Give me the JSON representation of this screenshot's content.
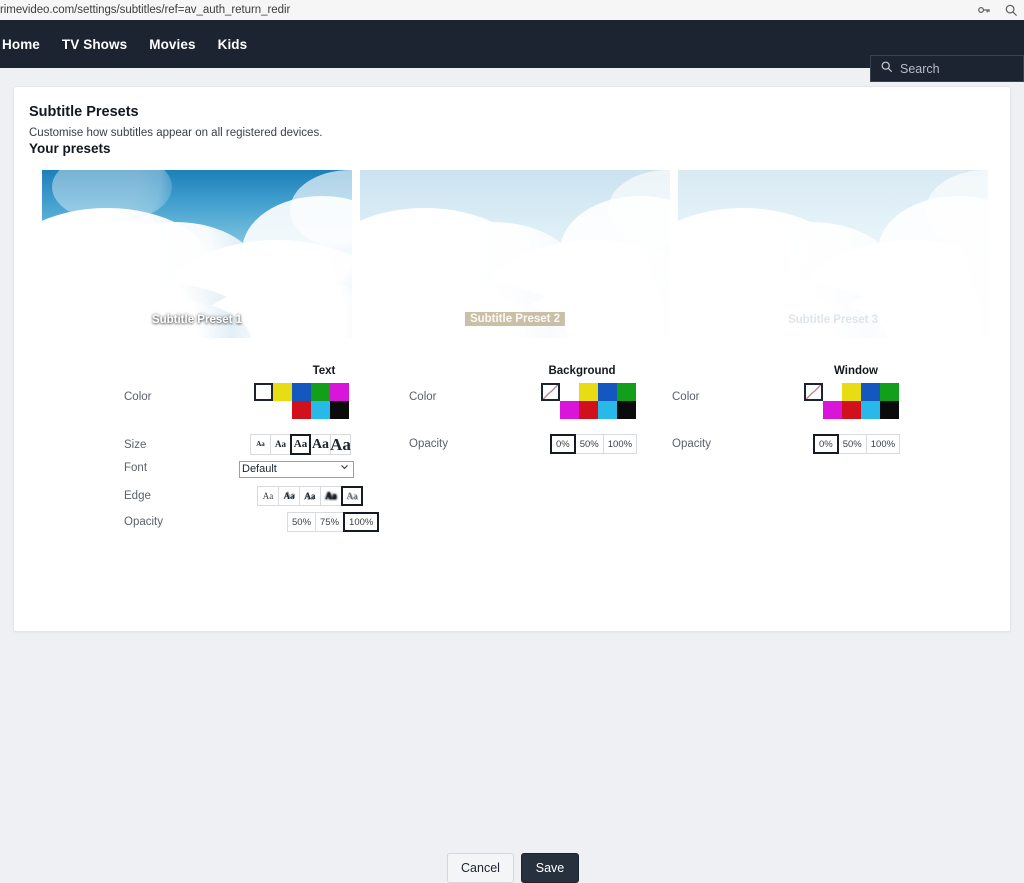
{
  "browser": {
    "url": "rimevideo.com/settings/subtitles/ref=av_auth_return_redir",
    "icons": {
      "key": "key-icon",
      "search": "search-icon"
    }
  },
  "nav": {
    "links": [
      {
        "label": "Home"
      },
      {
        "label": "TV Shows"
      },
      {
        "label": "Movies"
      },
      {
        "label": "Kids"
      }
    ],
    "search": {
      "placeholder": "Search",
      "value": ""
    }
  },
  "page": {
    "title": "Subtitle Presets",
    "subtitle": "Customise how subtitles appear on all registered devices.",
    "presets_heading": "Your presets"
  },
  "presets": [
    {
      "label": "Subtitle Preset 1",
      "selected": true
    },
    {
      "label": "Subtitle Preset 2",
      "selected": false
    },
    {
      "label": "Subtitle Preset 3",
      "selected": false
    }
  ],
  "columns": {
    "text": {
      "heading": "Text",
      "labels": {
        "color": "Color",
        "size": "Size",
        "font": "Font",
        "edge": "Edge",
        "opacity": "Opacity"
      },
      "colors": [
        {
          "name": "white",
          "hex": "#ffffff",
          "selected": true
        },
        {
          "name": "yellow",
          "hex": "#e8dc15",
          "selected": false
        },
        {
          "name": "blue",
          "hex": "#1457be",
          "selected": false
        },
        {
          "name": "green",
          "hex": "#12a01a",
          "selected": false
        },
        {
          "name": "magenta",
          "hex": "#d915d9",
          "selected": false
        },
        {
          "name": "red",
          "hex": "#d1101c",
          "selected": false
        },
        {
          "name": "cyan",
          "hex": "#28b9e8",
          "selected": false
        },
        {
          "name": "black",
          "hex": "#0b0b0b",
          "selected": false
        }
      ],
      "sizes": [
        {
          "label": "Aa",
          "selected": false
        },
        {
          "label": "Aa",
          "selected": false
        },
        {
          "label": "Aa",
          "selected": true
        },
        {
          "label": "Aa",
          "selected": false
        },
        {
          "label": "Aa",
          "selected": false
        }
      ],
      "font": {
        "value": "Default",
        "options": [
          "Default"
        ]
      },
      "edges": [
        {
          "label": "Aa",
          "style": "none",
          "selected": false
        },
        {
          "label": "Aa",
          "style": "raised",
          "selected": false
        },
        {
          "label": "Aa",
          "style": "depressed",
          "selected": false
        },
        {
          "label": "Aa",
          "style": "uniform",
          "selected": false
        },
        {
          "label": "Aa",
          "style": "drop-shadow",
          "selected": true
        }
      ],
      "opacities": [
        {
          "label": "50%",
          "selected": false
        },
        {
          "label": "75%",
          "selected": false
        },
        {
          "label": "100%",
          "selected": true
        }
      ]
    },
    "background": {
      "heading": "Background",
      "labels": {
        "color": "Color",
        "opacity": "Opacity"
      },
      "colors": [
        {
          "name": "transparent",
          "hex": "transparent",
          "selected": true
        },
        {
          "name": "white",
          "hex": "#ffffff",
          "selected": false
        },
        {
          "name": "yellow",
          "hex": "#e8dc15",
          "selected": false
        },
        {
          "name": "blue",
          "hex": "#1457be",
          "selected": false
        },
        {
          "name": "green",
          "hex": "#12a01a",
          "selected": false
        },
        {
          "name": "magenta",
          "hex": "#d915d9",
          "selected": false
        },
        {
          "name": "red",
          "hex": "#d1101c",
          "selected": false
        },
        {
          "name": "cyan",
          "hex": "#28b9e8",
          "selected": false
        },
        {
          "name": "black",
          "hex": "#0b0b0b",
          "selected": false
        }
      ],
      "opacities": [
        {
          "label": "0%",
          "selected": true
        },
        {
          "label": "50%",
          "selected": false
        },
        {
          "label": "100%",
          "selected": false
        }
      ]
    },
    "window": {
      "heading": "Window",
      "labels": {
        "color": "Color",
        "opacity": "Opacity"
      },
      "colors": [
        {
          "name": "transparent",
          "hex": "transparent",
          "selected": true
        },
        {
          "name": "white",
          "hex": "#ffffff",
          "selected": false
        },
        {
          "name": "yellow",
          "hex": "#e8dc15",
          "selected": false
        },
        {
          "name": "blue",
          "hex": "#1457be",
          "selected": false
        },
        {
          "name": "green",
          "hex": "#12a01a",
          "selected": false
        },
        {
          "name": "magenta",
          "hex": "#d915d9",
          "selected": false
        },
        {
          "name": "red",
          "hex": "#d1101c",
          "selected": false
        },
        {
          "name": "cyan",
          "hex": "#28b9e8",
          "selected": false
        },
        {
          "name": "black",
          "hex": "#0b0b0b",
          "selected": false
        }
      ],
      "opacities": [
        {
          "label": "0%",
          "selected": true
        },
        {
          "label": "50%",
          "selected": false
        },
        {
          "label": "100%",
          "selected": false
        }
      ]
    }
  },
  "footer": {
    "cancel_label": "Cancel",
    "save_label": "Save"
  },
  "theme": {
    "nav_background": "#1b2430",
    "save_background": "#27303d",
    "selection_outline": "#141b24"
  }
}
